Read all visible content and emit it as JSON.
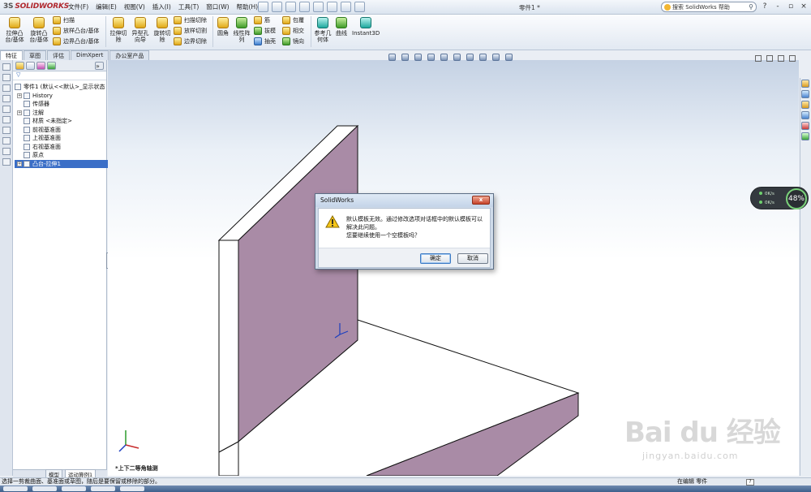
{
  "app": {
    "logo_prefix": "3S",
    "logo": "SOLIDWORKS",
    "document_title": "零件1 *",
    "search_placeholder": "搜索 SolidWorks 帮助"
  },
  "menu": [
    "文件(F)",
    "编辑(E)",
    "视图(V)",
    "插入(I)",
    "工具(T)",
    "窗口(W)",
    "帮助(H)"
  ],
  "window_controls": [
    "?",
    "-",
    "▫",
    "×"
  ],
  "ribbon": {
    "big_buttons": [
      {
        "label": "拉伸凸\n台/基体",
        "icon": "extrude-boss-icon"
      },
      {
        "label": "旋转凸\n台/基体",
        "icon": "revolve-boss-icon"
      },
      {
        "label": "拉伸切\n除",
        "icon": "extrude-cut-icon"
      },
      {
        "label": "异型孔\n向导",
        "icon": "hole-wizard-icon"
      },
      {
        "label": "旋转切\n除",
        "icon": "revolve-cut-icon"
      },
      {
        "label": "圆角",
        "icon": "fillet-icon"
      },
      {
        "label": "线性阵\n列",
        "icon": "linear-pattern-icon"
      },
      {
        "label": "参考几\n何体",
        "icon": "reference-geometry-icon"
      },
      {
        "label": "曲线",
        "icon": "curves-icon"
      },
      {
        "label": "Instant3D",
        "icon": "instant3d-icon"
      }
    ],
    "small_groups": [
      [
        "扫描",
        "放样凸台/基体",
        "边界凸台/基体"
      ],
      [
        "扫描切除",
        "放样切割",
        "边界切除"
      ],
      [
        "筋",
        "拔模",
        "抽壳"
      ],
      [
        "包覆",
        "相交",
        "镜向"
      ]
    ]
  },
  "command_tabs": [
    "特征",
    "草图",
    "评估",
    "DimXpert",
    "办公室产品"
  ],
  "feature_manager": {
    "tree": [
      {
        "label": "零件1  (默认<<默认>_显示状态",
        "expand": "",
        "selected": false
      },
      {
        "label": "History",
        "expand": "+",
        "selected": false
      },
      {
        "label": "传感器",
        "expand": "",
        "selected": false
      },
      {
        "label": "注解",
        "expand": "+",
        "selected": false
      },
      {
        "label": "材质 <未指定>",
        "expand": "",
        "selected": false
      },
      {
        "label": "前视基准面",
        "expand": "",
        "selected": false
      },
      {
        "label": "上视基准面",
        "expand": "",
        "selected": false
      },
      {
        "label": "右视基准面",
        "expand": "",
        "selected": false
      },
      {
        "label": "原点",
        "expand": "",
        "selected": false
      },
      {
        "label": "凸台-拉伸1",
        "expand": "+",
        "selected": true
      }
    ],
    "bottom_tabs": [
      "模型",
      "运动算例1"
    ]
  },
  "viewport": {
    "view_label": "*上下二等角轴测"
  },
  "gauge": {
    "up": "0K/s",
    "down": "0K/s",
    "percent": "48%"
  },
  "dialog": {
    "title": "SolidWorks",
    "message_line1": "默认模板无效。通过修改选项对话框中的默认模板可以解决此问题。",
    "message_line2": "您要继续使用一个空模板吗？",
    "ok_label": "确定",
    "cancel_label": "取消",
    "close_label": "x"
  },
  "status": {
    "hint": "选择一剪裁曲面、基准面或草图，随后是要保留或移除的部分。",
    "mode": "在编辑 零件",
    "help": "?"
  },
  "watermark": {
    "brand": "Bai du 经验",
    "url": "jingyan.baidu.com"
  },
  "colors": {
    "model_face": "#a98ba6",
    "accent": "#3b6fc7",
    "logo_red": "#b0282e"
  }
}
